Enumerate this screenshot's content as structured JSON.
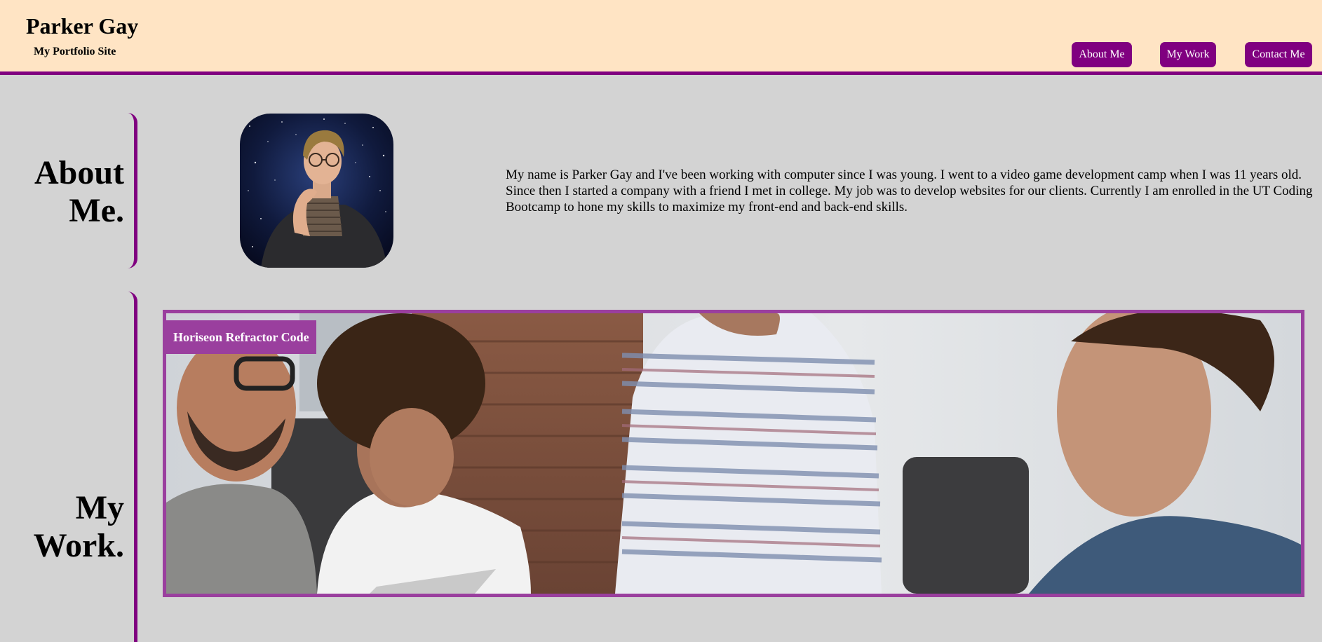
{
  "header": {
    "title": "Parker Gay",
    "subtitle": "My Portfolio Site",
    "nav": [
      {
        "label": "About Me"
      },
      {
        "label": "My Work"
      },
      {
        "label": "Contact Me"
      }
    ]
  },
  "about": {
    "heading_line1": "About",
    "heading_line2": "Me.",
    "bio": "My name is Parker Gay and I've been working with computer since I was young. I went to a video game development camp when I was 11 years old. Since then I started a company with a friend I met in college. My job was to develop websites for our clients. Currently I am enrolled in the UT Coding Bootcamp to hone my skills to maximize my front-end and back-end skills."
  },
  "work": {
    "heading_line1": "My",
    "heading_line2": "Work.",
    "projects": [
      {
        "title": "Horiseon Refractor Code"
      }
    ]
  },
  "colors": {
    "header_bg": "#ffe4c4",
    "accent": "#800080",
    "card_accent": "#9a3f9e",
    "page_bg": "#d3d3d3"
  }
}
